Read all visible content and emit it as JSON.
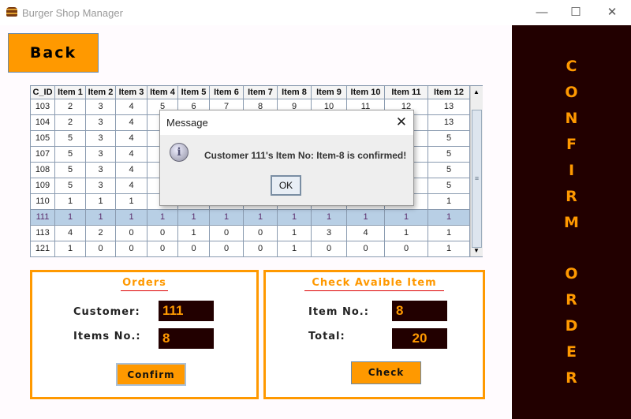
{
  "window": {
    "title": "Burger Shop Manager",
    "minimize": "—",
    "maximize": "☐",
    "close": "✕"
  },
  "back_label": "Back",
  "table": {
    "headers": [
      "C_ID",
      "Item 1",
      "Item 2",
      "Item 3",
      "Item 4",
      "Item 5",
      "Item 6",
      "Item 7",
      "Item 8",
      "Item 9",
      "Item 10",
      "Item 11",
      "Item 12"
    ],
    "rows": [
      [
        "103",
        "2",
        "3",
        "4",
        "5",
        "6",
        "7",
        "8",
        "9",
        "10",
        "11",
        "12",
        "13"
      ],
      [
        "104",
        "2",
        "3",
        "4",
        "",
        "",
        "",
        "",
        "",
        "",
        "",
        "",
        "13"
      ],
      [
        "105",
        "5",
        "3",
        "4",
        "",
        "",
        "",
        "",
        "",
        "",
        "",
        "",
        "5"
      ],
      [
        "107",
        "5",
        "3",
        "4",
        "",
        "",
        "",
        "",
        "",
        "",
        "",
        "",
        "5"
      ],
      [
        "108",
        "5",
        "3",
        "4",
        "",
        "",
        "",
        "",
        "",
        "",
        "",
        "",
        "5"
      ],
      [
        "109",
        "5",
        "3",
        "4",
        "",
        "",
        "",
        "",
        "",
        "",
        "",
        "",
        "5"
      ],
      [
        "110",
        "1",
        "1",
        "1",
        "",
        "",
        "",
        "",
        "",
        "",
        "",
        "",
        "1"
      ],
      [
        "111",
        "1",
        "1",
        "1",
        "1",
        "1",
        "1",
        "1",
        "1",
        "1",
        "1",
        "1",
        "1"
      ],
      [
        "113",
        "4",
        "2",
        "0",
        "0",
        "1",
        "0",
        "0",
        "1",
        "3",
        "4",
        "1",
        "1"
      ],
      [
        "121",
        "1",
        "0",
        "0",
        "0",
        "0",
        "0",
        "0",
        "1",
        "0",
        "0",
        "0",
        "1"
      ]
    ],
    "selected_row": "111"
  },
  "dialog": {
    "title": "Message",
    "message": "Customer 111's Item No: Item-8 is confirmed!",
    "ok": "OK",
    "close": "✕",
    "icon": "info-icon"
  },
  "orders": {
    "title": "Orders",
    "customer_label": "Customer:",
    "customer_value": "111",
    "items_label": "Items No.:",
    "items_value": "8",
    "confirm": "Confirm"
  },
  "check": {
    "title": "Check Avaible Item",
    "item_label": "Item No.:",
    "item_value": "8",
    "total_label": "Total:",
    "total_value": "20",
    "check": "Check"
  },
  "side": {
    "confirm": "CONFIRM",
    "order": "ORDER"
  },
  "colors": {
    "accent": "#ff9900",
    "dark": "#220000"
  }
}
